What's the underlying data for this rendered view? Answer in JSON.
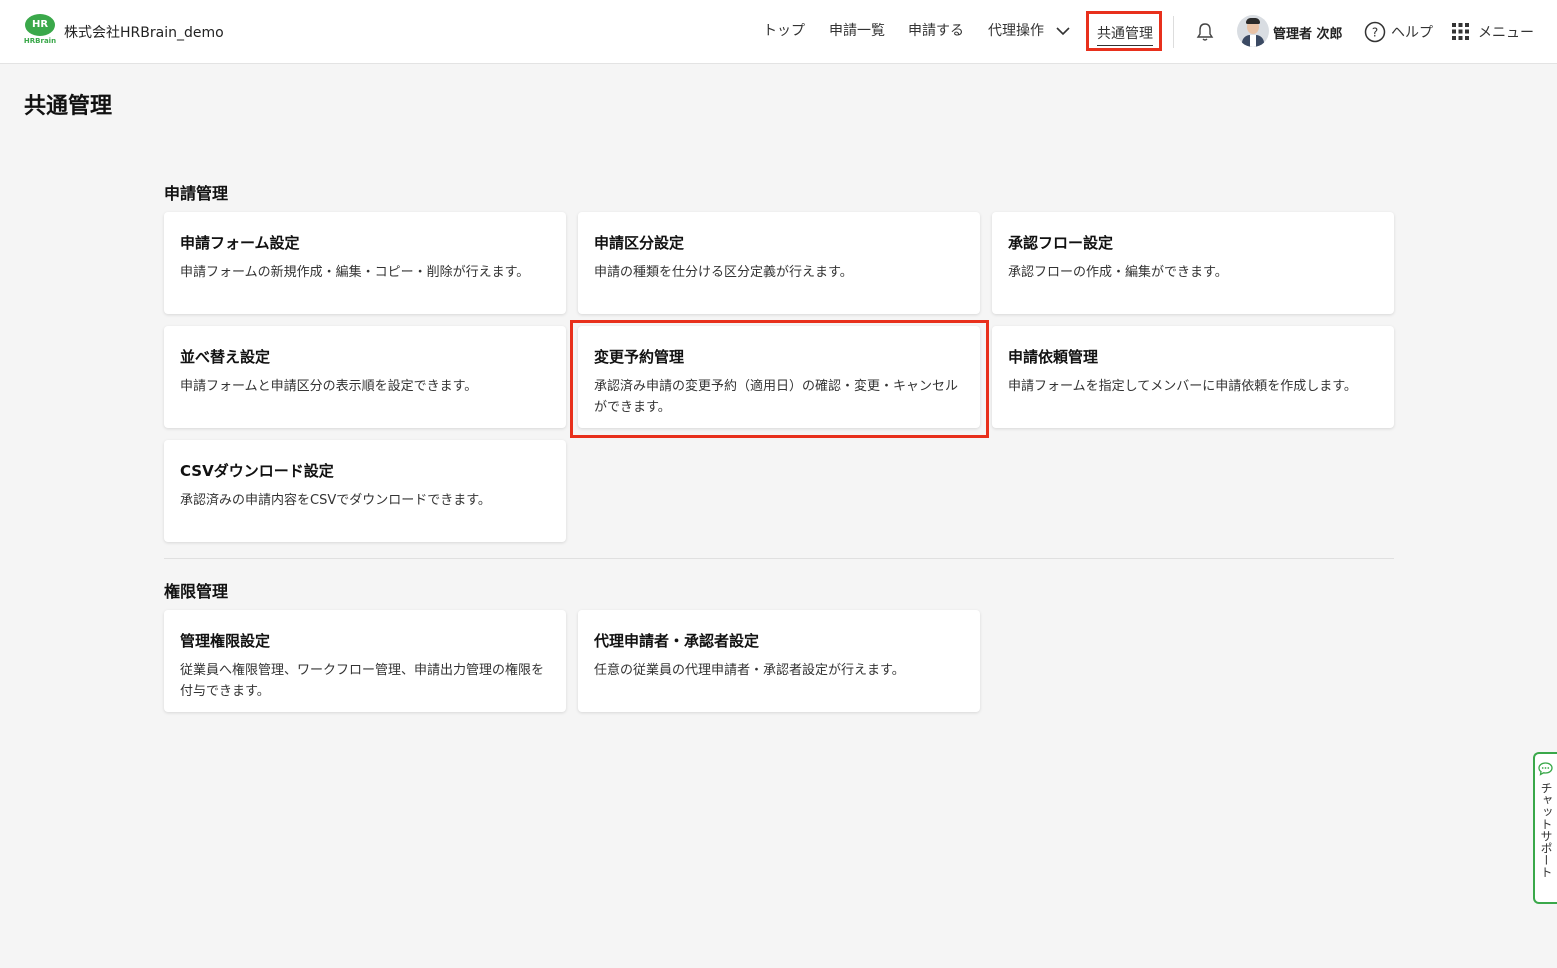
{
  "header": {
    "logo_mark": "HR",
    "logo_text": "HRBrain",
    "company": "株式会社HRBrain_demo",
    "nav": [
      "トップ",
      "申請一覧",
      "申請する",
      "代理操作"
    ],
    "nav_active": "共通管理",
    "username": "管理者 次郎",
    "help": "ヘルプ",
    "menu": "メニュー"
  },
  "page_title": "共通管理",
  "sections": [
    {
      "title": "申請管理",
      "cards": [
        {
          "title": "申請フォーム設定",
          "desc": "申請フォームの新規作成・編集・コピー・削除が行えます。"
        },
        {
          "title": "申請区分設定",
          "desc": "申請の種類を仕分ける区分定義が行えます。"
        },
        {
          "title": "承認フロー設定",
          "desc": "承認フローの作成・編集ができます。"
        },
        {
          "title": "並べ替え設定",
          "desc": "申請フォームと申請区分の表示順を設定できます。"
        },
        {
          "title": "変更予約管理",
          "desc": "承認済み申請の変更予約（適用日）の確認・変更・キャンセルができます。"
        },
        {
          "title": "申請依頼管理",
          "desc": "申請フォームを指定してメンバーに申請依頼を作成します。"
        },
        {
          "title": "CSVダウンロード設定",
          "desc": "承認済みの申請内容をCSVでダウンロードできます。"
        }
      ]
    },
    {
      "title": "権限管理",
      "cards": [
        {
          "title": "管理権限設定",
          "desc": "従業員へ権限管理、ワークフロー管理、申請出力管理の権限を付与できます。"
        },
        {
          "title": "代理申請者・承認者設定",
          "desc": "任意の従業員の代理申請者・承認者設定が行えます。"
        }
      ]
    }
  ],
  "chat_support": "チャットサポート",
  "colors": {
    "brand": "#3aa84a",
    "highlight": "#e8301c"
  }
}
